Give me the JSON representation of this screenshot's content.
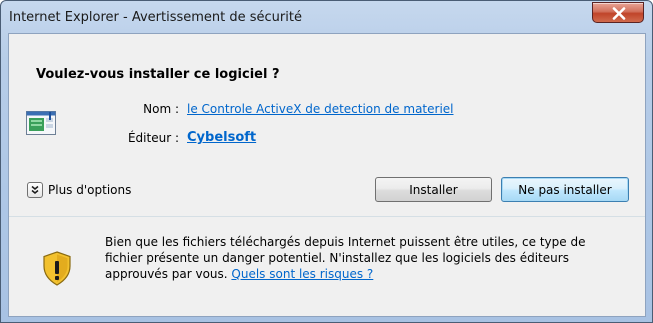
{
  "window": {
    "title": "Internet Explorer - Avertissement de sécurité",
    "close_icon": "close-icon"
  },
  "prompt": {
    "question": "Voulez-vous installer ce logiciel ?",
    "name_label": "Nom :",
    "name_value": "le Controle ActiveX de detection de materiel",
    "publisher_label": "Éditeur :",
    "publisher_value": "Cybelsoft",
    "program_icon": "activex-program-icon"
  },
  "options": {
    "label": "Plus d'options",
    "icon": "chevron-down-icon"
  },
  "buttons": {
    "install": "Installer",
    "no_install": "Ne pas installer"
  },
  "warning": {
    "icon": "warning-shield-icon",
    "text": "Bien que les fichiers téléchargés depuis Internet puissent être utiles, ce type de fichier présente un danger potentiel. N'installez que les logiciels des éditeurs approuvés par vous. ",
    "link": "Quels sont les risques ?"
  },
  "colors": {
    "link": "#0066cc",
    "default_button_border": "#3c7fb1",
    "close_button": "#c0442a",
    "shield_yellow": "#f2c12e"
  }
}
